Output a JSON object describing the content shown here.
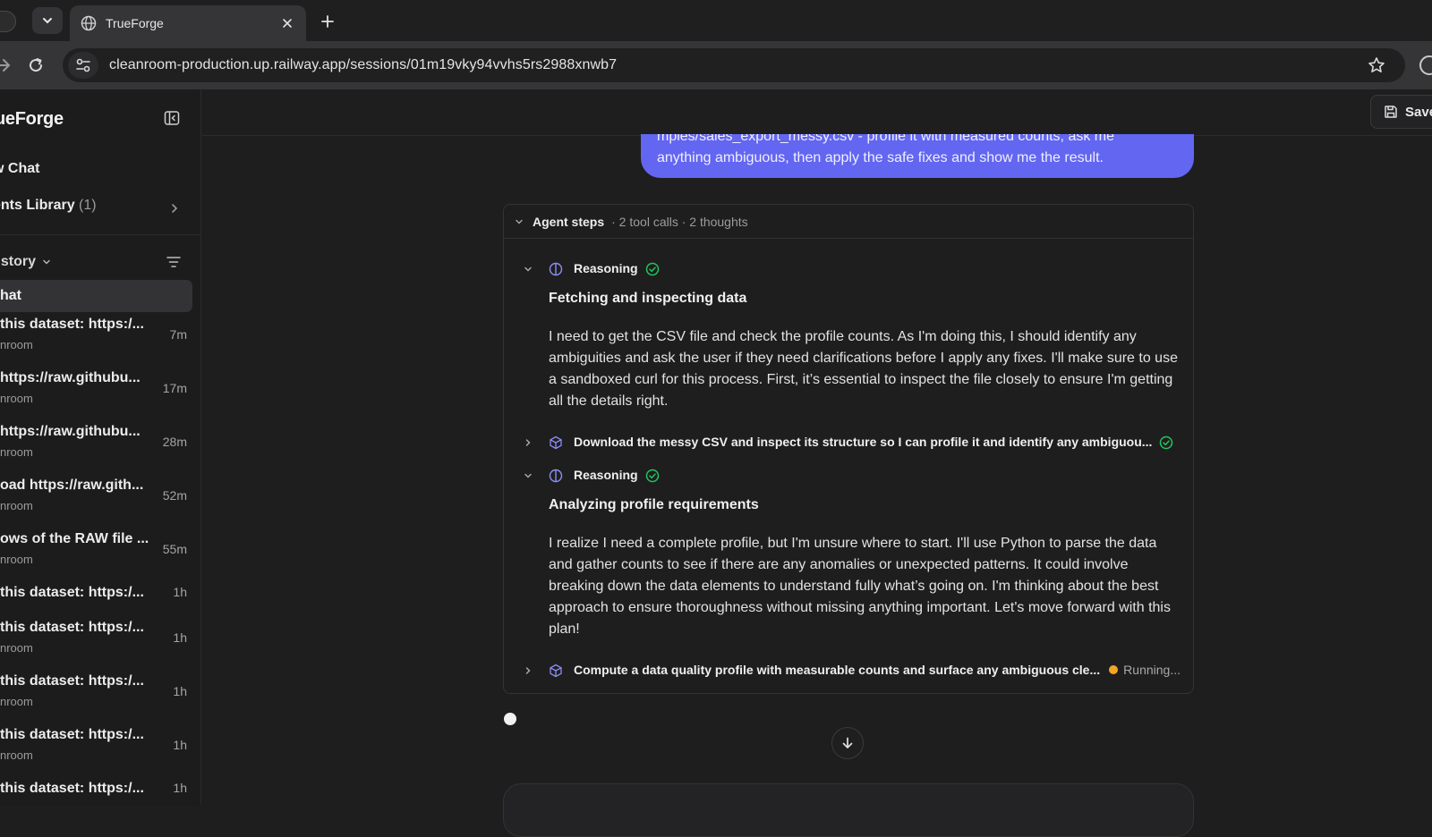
{
  "browser": {
    "tab_title": "TrueForge",
    "url": "cleanroom-production.up.railway.app/sessions/01m19vky94vvhs5rs2988xnwb7"
  },
  "sidebar": {
    "brand": "ueForge",
    "new_chat": "w Chat",
    "library_label": "ents Library",
    "library_count": "(1)",
    "history_label": "listory",
    "active_chat": "hat",
    "history": [
      {
        "title": "this dataset: https:/...",
        "sub": "nroom",
        "time": "7m"
      },
      {
        "title": "https://raw.githubu...",
        "sub": "nroom",
        "time": "17m"
      },
      {
        "title": "https://raw.githubu...",
        "sub": "nroom",
        "time": "28m"
      },
      {
        "title": "oad https://raw.gith...",
        "sub": "nroom",
        "time": "52m"
      },
      {
        "title": "ows of the RAW file ...",
        "sub": "nroom",
        "time": "55m"
      },
      {
        "title": "this dataset: https:/...",
        "sub": "",
        "time": "1h"
      },
      {
        "title": "this dataset: https:/...",
        "sub": "nroom",
        "time": "1h"
      },
      {
        "title": "this dataset: https:/...",
        "sub": "nroom",
        "time": "1h"
      },
      {
        "title": "this dataset: https:/...",
        "sub": "nroom",
        "time": "1h"
      },
      {
        "title": "this dataset: https:/...",
        "sub": "",
        "time": "1h"
      }
    ]
  },
  "header": {
    "save_label": "Save"
  },
  "chat": {
    "user_message_line1": "mples/sales_export_messy.csv - profile it with measured counts, ask me",
    "user_message_line2": "anything ambiguous, then apply the safe fixes and show me the result.",
    "agent_steps": {
      "title": "Agent steps",
      "meta": "· 2 tool calls · 2 thoughts",
      "reasoning_label": "Reasoning",
      "step1_heading": "Fetching and inspecting data",
      "step1_body": "I need to get the CSV file and check the profile counts. As I'm doing this, I should identify any ambiguities and ask the user if they need clarifications before I apply any fixes. I'll make sure to use a sandboxed curl for this process. First, it’s essential to inspect the file closely to ensure I'm getting all the details right.",
      "tool1": "Download the messy CSV and inspect its structure so I can profile it and identify any ambiguou...",
      "step2_heading": "Analyzing profile requirements",
      "step2_body": "I realize I need a complete profile, but I'm unsure where to start. I'll use Python to parse the data and gather counts to see if there are any anomalies or unexpected patterns. It could involve breaking down the data elements to understand fully what’s going on. I'm thinking about the best approach to ensure thoroughness without missing anything important. Let's move forward with this plan!",
      "tool2": "Compute a data quality profile with measurable counts and surface any ambiguous cle...",
      "running_label": "Running..."
    }
  },
  "colors": {
    "accent": "#6366f1",
    "success": "#22c55e",
    "running": "#f5a524"
  }
}
